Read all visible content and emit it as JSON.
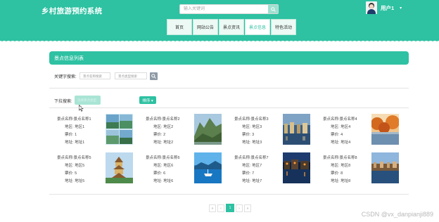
{
  "app": {
    "title": "乡村旅游预约系统"
  },
  "search": {
    "placeholder": "输入关键词"
  },
  "user": {
    "name": "用户1",
    "caret": "▾"
  },
  "nav": {
    "items": [
      {
        "label": "首页",
        "active": false
      },
      {
        "label": "网站公告",
        "active": false
      },
      {
        "label": "景点资讯",
        "active": false
      },
      {
        "label": "景点信息",
        "active": true
      },
      {
        "label": "特色活动",
        "active": false
      }
    ]
  },
  "panel": {
    "title": "景点信息列表"
  },
  "filters": {
    "keyword_label": "关键字搜索:",
    "name_placeholder": "景点名称搜索",
    "type_placeholder": "景点类型搜索",
    "dropdown_label": "下拉搜索:",
    "dropdown_placeholder": "选择景点类型",
    "sort_label": "排序 ▾"
  },
  "spot_labels": {
    "name": "景点名称:",
    "region": "地区:",
    "price": "票价:",
    "address": "地址:"
  },
  "spots": [
    {
      "name": "景点名称1",
      "region": "地区1",
      "price": "1",
      "address": "地址1"
    },
    {
      "name": "景点名称2",
      "region": "地区2",
      "price": "2",
      "address": "地址2"
    },
    {
      "name": "景点名称3",
      "region": "地区3",
      "price": "3",
      "address": "地址3"
    },
    {
      "name": "景点名称4",
      "region": "地区4",
      "price": "4",
      "address": "地址4"
    },
    {
      "name": "景点名称5",
      "region": "地区5",
      "price": "5",
      "address": "地址5"
    },
    {
      "name": "景点名称6",
      "region": "地区6",
      "price": "6",
      "address": "地址6"
    },
    {
      "name": "景点名称7",
      "region": "地区7",
      "price": "7",
      "address": "地址7"
    },
    {
      "name": "景点名称8",
      "region": "地区8",
      "price": "8",
      "address": "地址8"
    }
  ],
  "pagination": {
    "first": "«",
    "prev": "‹",
    "current": "1",
    "next": "›",
    "last": "»"
  },
  "watermark": "CSDN @vx_danpianji889",
  "colors": {
    "accent": "#2ec1a2",
    "light_accent": "#a9e4d4",
    "search_button": "#8e9aa5"
  }
}
